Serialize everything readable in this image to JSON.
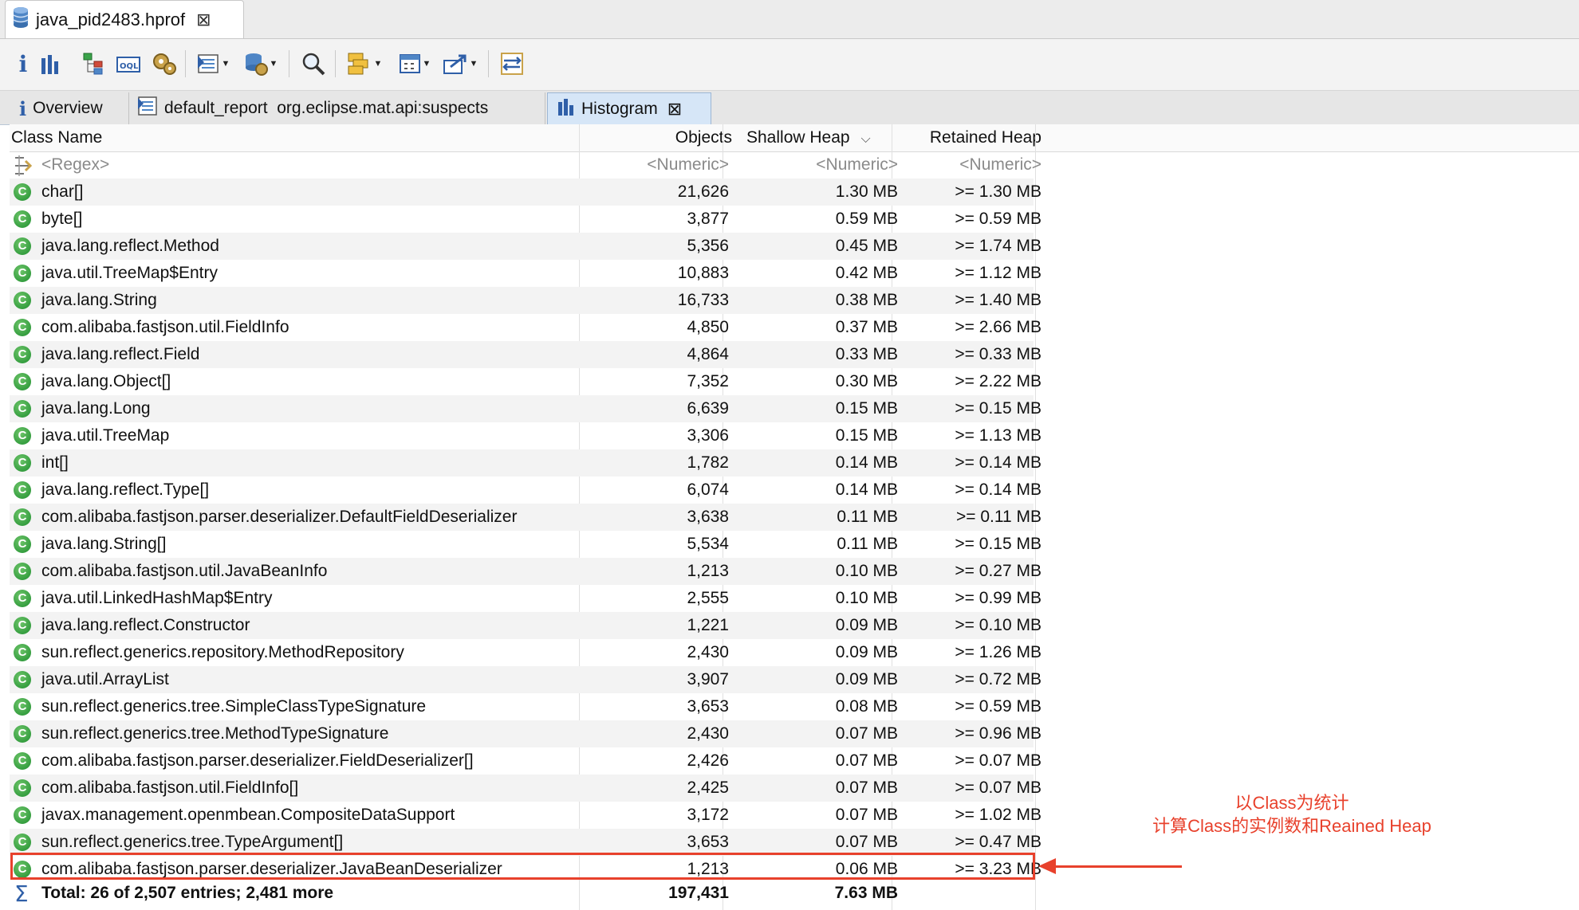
{
  "editor_tab": {
    "title": "java_pid2483.hprof",
    "close": "⊠"
  },
  "toolbar": {
    "items": [
      "info-icon",
      "histogram-icon",
      "dominator-tree-icon",
      "oql-icon",
      "heap-dump-overview-icon",
      "run-report-icon",
      "query-browser-icon",
      "search-icon",
      "group-by-icon",
      "calculate-retained-icon",
      "export-icon",
      "compare-icon"
    ]
  },
  "view_tabs": [
    {
      "label": "Overview"
    },
    {
      "label": "default_report  org.eclipse.mat.api:suspects"
    },
    {
      "label": "Histogram",
      "close": "⊠"
    }
  ],
  "table": {
    "columns": [
      "Class Name",
      "Objects",
      "Shallow Heap",
      "Retained Heap"
    ],
    "sort_indicator": "⌵",
    "filter_row": {
      "class": "<Regex>",
      "objects": "<Numeric>",
      "shallow": "<Numeric>",
      "retained": "<Numeric>"
    },
    "rows": [
      {
        "class": "char[]",
        "objects": "21,626",
        "shallow": "1.30 MB",
        "retained": ">= 1.30 MB"
      },
      {
        "class": "byte[]",
        "objects": "3,877",
        "shallow": "0.59 MB",
        "retained": ">= 0.59 MB"
      },
      {
        "class": "java.lang.reflect.Method",
        "objects": "5,356",
        "shallow": "0.45 MB",
        "retained": ">= 1.74 MB"
      },
      {
        "class": "java.util.TreeMap$Entry",
        "objects": "10,883",
        "shallow": "0.42 MB",
        "retained": ">= 1.12 MB"
      },
      {
        "class": "java.lang.String",
        "objects": "16,733",
        "shallow": "0.38 MB",
        "retained": ">= 1.40 MB"
      },
      {
        "class": "com.alibaba.fastjson.util.FieldInfo",
        "objects": "4,850",
        "shallow": "0.37 MB",
        "retained": ">= 2.66 MB"
      },
      {
        "class": "java.lang.reflect.Field",
        "objects": "4,864",
        "shallow": "0.33 MB",
        "retained": ">= 0.33 MB"
      },
      {
        "class": "java.lang.Object[]",
        "objects": "7,352",
        "shallow": "0.30 MB",
        "retained": ">= 2.22 MB"
      },
      {
        "class": "java.lang.Long",
        "objects": "6,639",
        "shallow": "0.15 MB",
        "retained": ">= 0.15 MB"
      },
      {
        "class": "java.util.TreeMap",
        "objects": "3,306",
        "shallow": "0.15 MB",
        "retained": ">= 1.13 MB"
      },
      {
        "class": "int[]",
        "objects": "1,782",
        "shallow": "0.14 MB",
        "retained": ">= 0.14 MB"
      },
      {
        "class": "java.lang.reflect.Type[]",
        "objects": "6,074",
        "shallow": "0.14 MB",
        "retained": ">= 0.14 MB"
      },
      {
        "class": "com.alibaba.fastjson.parser.deserializer.DefaultFieldDeserializer",
        "objects": "3,638",
        "shallow": "0.11 MB",
        "retained": ">= 0.11 MB"
      },
      {
        "class": "java.lang.String[]",
        "objects": "5,534",
        "shallow": "0.11 MB",
        "retained": ">= 0.15 MB"
      },
      {
        "class": "com.alibaba.fastjson.util.JavaBeanInfo",
        "objects": "1,213",
        "shallow": "0.10 MB",
        "retained": ">= 0.27 MB"
      },
      {
        "class": "java.util.LinkedHashMap$Entry",
        "objects": "2,555",
        "shallow": "0.10 MB",
        "retained": ">= 0.99 MB"
      },
      {
        "class": "java.lang.reflect.Constructor",
        "objects": "1,221",
        "shallow": "0.09 MB",
        "retained": ">= 0.10 MB"
      },
      {
        "class": "sun.reflect.generics.repository.MethodRepository",
        "objects": "2,430",
        "shallow": "0.09 MB",
        "retained": ">= 1.26 MB"
      },
      {
        "class": "java.util.ArrayList",
        "objects": "3,907",
        "shallow": "0.09 MB",
        "retained": ">= 0.72 MB"
      },
      {
        "class": "sun.reflect.generics.tree.SimpleClassTypeSignature",
        "objects": "3,653",
        "shallow": "0.08 MB",
        "retained": ">= 0.59 MB"
      },
      {
        "class": "sun.reflect.generics.tree.MethodTypeSignature",
        "objects": "2,430",
        "shallow": "0.07 MB",
        "retained": ">= 0.96 MB"
      },
      {
        "class": "com.alibaba.fastjson.parser.deserializer.FieldDeserializer[]",
        "objects": "2,426",
        "shallow": "0.07 MB",
        "retained": ">= 0.07 MB"
      },
      {
        "class": "com.alibaba.fastjson.util.FieldInfo[]",
        "objects": "2,425",
        "shallow": "0.07 MB",
        "retained": ">= 0.07 MB"
      },
      {
        "class": "javax.management.openmbean.CompositeDataSupport",
        "objects": "3,172",
        "shallow": "0.07 MB",
        "retained": ">= 1.02 MB"
      },
      {
        "class": "sun.reflect.generics.tree.TypeArgument[]",
        "objects": "3,653",
        "shallow": "0.07 MB",
        "retained": ">= 0.47 MB"
      },
      {
        "class": "com.alibaba.fastjson.parser.deserializer.JavaBeanDeserializer",
        "objects": "1,213",
        "shallow": "0.06 MB",
        "retained": ">= 3.23 MB"
      }
    ],
    "total": {
      "label": "Total: 26 of 2,507 entries; 2,481 more",
      "objects": "197,431",
      "shallow": "7.63 MB"
    }
  },
  "annotation": {
    "line1": "以Class为统计",
    "line2": "计算Class的实例数和Reained Heap",
    "color": "#e8412c"
  },
  "colors": {
    "class_icon": "#2e9e3a",
    "active_tab": "#d6e6f7",
    "accent": "#e8412c"
  }
}
